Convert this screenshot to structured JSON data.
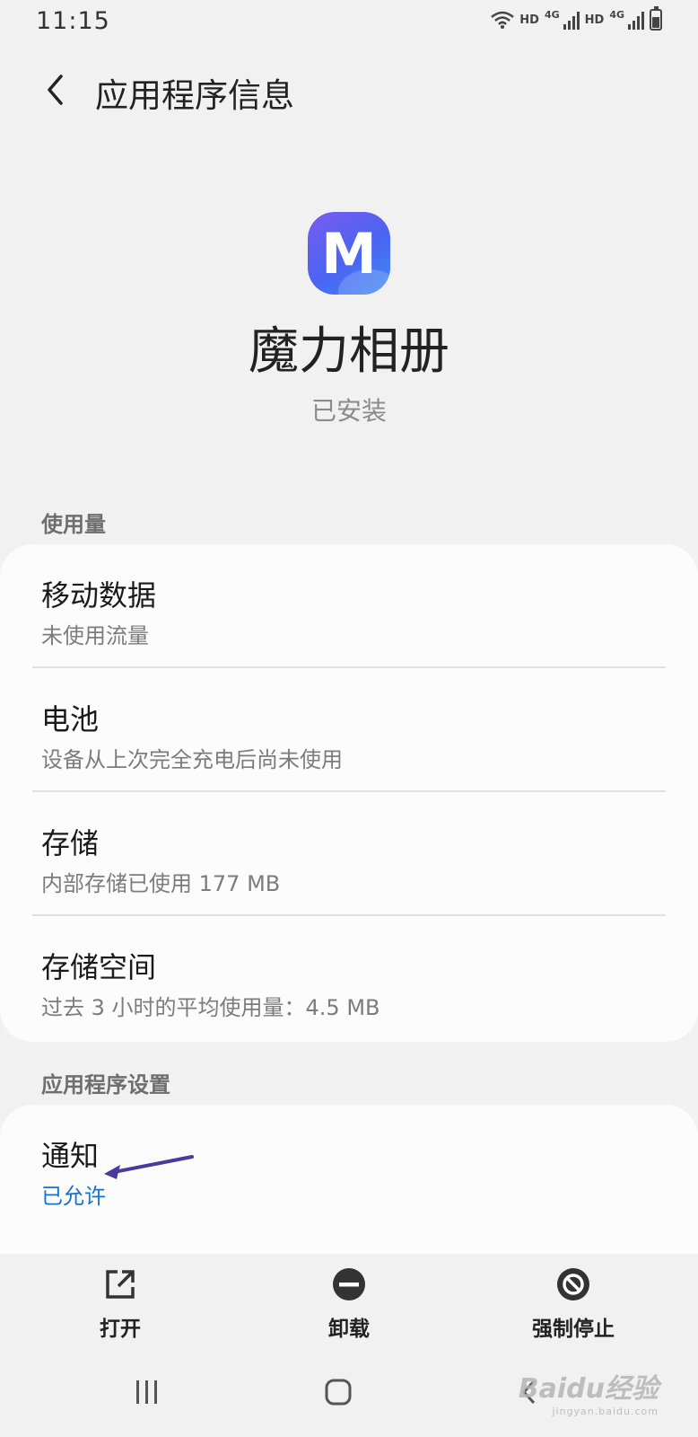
{
  "status_bar": {
    "time": "11:15",
    "hd_label": "HD",
    "network_label": "4G"
  },
  "header": {
    "title": "应用程序信息"
  },
  "app": {
    "icon_letter": "M",
    "name": "魔力相册",
    "status": "已安装"
  },
  "usage_section": {
    "header": "使用量",
    "items": [
      {
        "title": "移动数据",
        "subtitle": "未使用流量"
      },
      {
        "title": "电池",
        "subtitle": "设备从上次完全充电后尚未使用"
      },
      {
        "title": "存储",
        "subtitle": "内部存储已使用 177 MB"
      },
      {
        "title": "存储空间",
        "subtitle": "过去 3 小时的平均使用量：4.5 MB"
      }
    ]
  },
  "settings_section": {
    "header": "应用程序设置",
    "items": [
      {
        "title": "通知",
        "subtitle": "已允许"
      }
    ]
  },
  "actions": {
    "open_label": "打开",
    "uninstall_label": "卸载",
    "force_stop_label": "强制停止"
  },
  "watermark": {
    "brand": "Baidu经验",
    "url": "jingyan.baidu.com"
  },
  "colors": {
    "background": "#f1f1f1",
    "card": "#fcfcfc",
    "accent_blue": "#1a72c9",
    "annotation_arrow": "#4b3a9e"
  },
  "icons": {
    "back": "chevron-left-icon",
    "open": "open-external-icon",
    "uninstall": "minus-circle-icon",
    "force_stop": "block-circle-icon",
    "nav_recents": "recents-icon",
    "nav_home": "home-icon",
    "nav_back": "nav-back-icon"
  }
}
